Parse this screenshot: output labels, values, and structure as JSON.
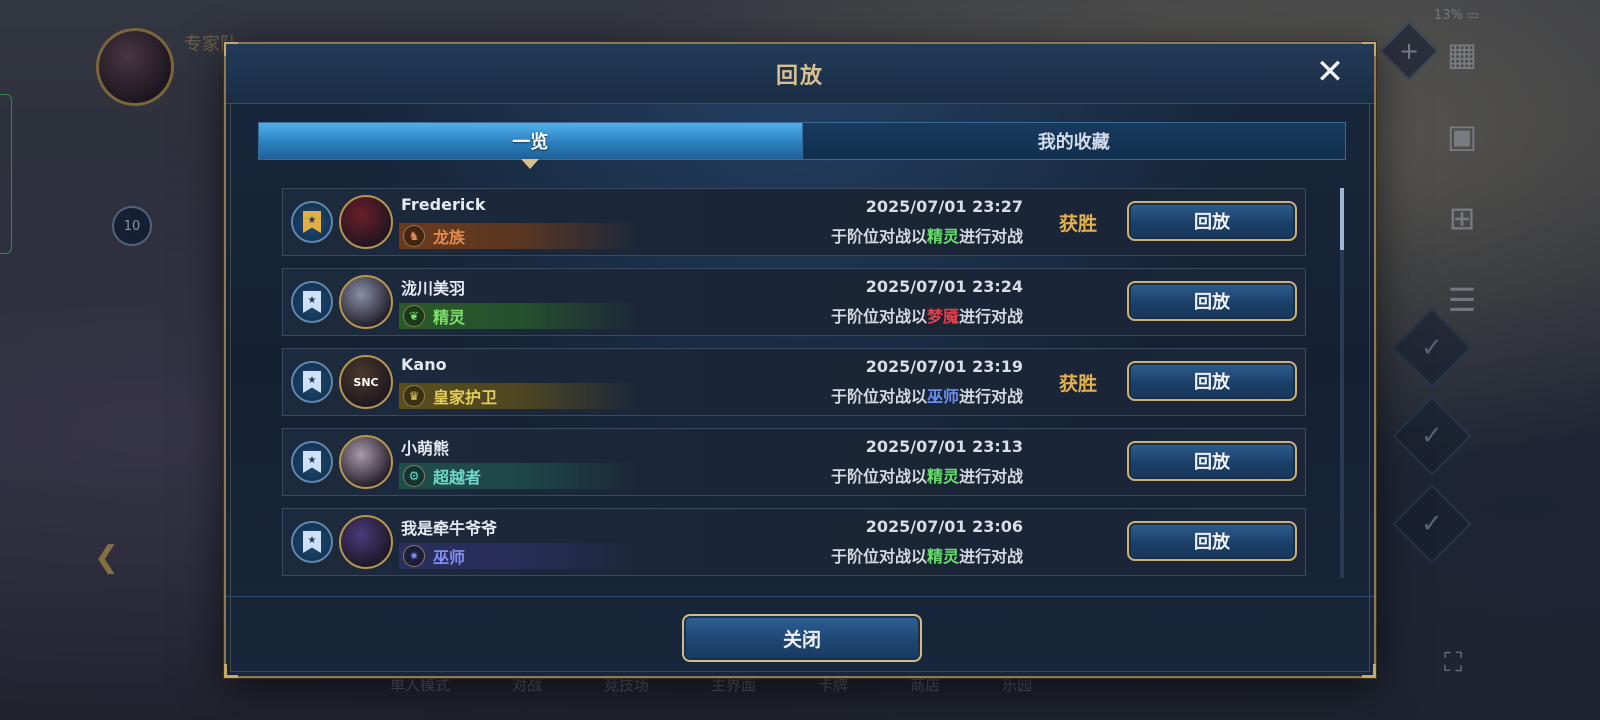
{
  "background": {
    "battery_text": "13%",
    "player_name": "专家队",
    "rank_number": "10",
    "bottom_nav": [
      "单人模式",
      "对战",
      "竞技场",
      "主界面",
      "卡牌",
      "商店",
      "乐园"
    ]
  },
  "modal": {
    "title": "回放",
    "close_x": "✕",
    "tabs": [
      {
        "label": "一览",
        "active": true
      },
      {
        "label": "我的收藏",
        "active": false
      }
    ],
    "close_button_label": "关闭",
    "rows": [
      {
        "player": "Frederick",
        "avatar_bg": "#6a1f2a",
        "avatar_text": "",
        "class_name": "龙族",
        "class_icon": "♞",
        "class_color": "#e38a4e",
        "class_strip_color": "#6b3a1c",
        "date": "2025/07/01  23:27",
        "desc_prefix": "于阶位对战以",
        "desc_class": "精灵",
        "desc_class_color": "#66e06a",
        "desc_suffix": "进行对战",
        "result": "获胜",
        "favorited": true,
        "replay_label": "回放"
      },
      {
        "player": "泷川美羽",
        "avatar_bg": "#8a8fa8",
        "avatar_text": "",
        "class_name": "精灵",
        "class_icon": "❦",
        "class_color": "#7ee06a",
        "class_strip_color": "#2a5a2a",
        "date": "2025/07/01  23:24",
        "desc_prefix": "于阶位对战以",
        "desc_class": "梦魇",
        "desc_class_color": "#e0404a",
        "desc_suffix": "进行对战",
        "result": "",
        "favorited": false,
        "replay_label": "回放"
      },
      {
        "player": "Kano",
        "avatar_bg": "#4a3a2a",
        "avatar_text": "SNC",
        "class_name": "皇家护卫",
        "class_icon": "♛",
        "class_color": "#e4cf5a",
        "class_strip_color": "#5a4e1c",
        "date": "2025/07/01  23:19",
        "desc_prefix": "于阶位对战以",
        "desc_class": "巫师",
        "desc_class_color": "#6b8ef0",
        "desc_suffix": "进行对战",
        "result": "获胜",
        "favorited": false,
        "replay_label": "回放"
      },
      {
        "player": "小萌熊",
        "avatar_bg": "#a89aa8",
        "avatar_text": "",
        "class_name": "超越者",
        "class_icon": "⚙",
        "class_color": "#6fd8c8",
        "class_strip_color": "#1f4e4c",
        "date": "2025/07/01  23:13",
        "desc_prefix": "于阶位对战以",
        "desc_class": "精灵",
        "desc_class_color": "#66e06a",
        "desc_suffix": "进行对战",
        "result": "",
        "favorited": false,
        "replay_label": "回放"
      },
      {
        "player": "我是牵牛爷爷",
        "avatar_bg": "#4a3a7a",
        "avatar_text": "",
        "class_name": "巫师",
        "class_icon": "✷",
        "class_color": "#7f8ff0",
        "class_strip_color": "#2a2f5e",
        "date": "2025/07/01  23:06",
        "desc_prefix": "于阶位对战以",
        "desc_class": "精灵",
        "desc_class_color": "#66e06a",
        "desc_suffix": "进行对战",
        "result": "",
        "favorited": false,
        "replay_label": "回放"
      }
    ]
  },
  "colors": {
    "gold": "#d9c08c",
    "tab_active": "#3a96d6",
    "panel": "#142133"
  }
}
